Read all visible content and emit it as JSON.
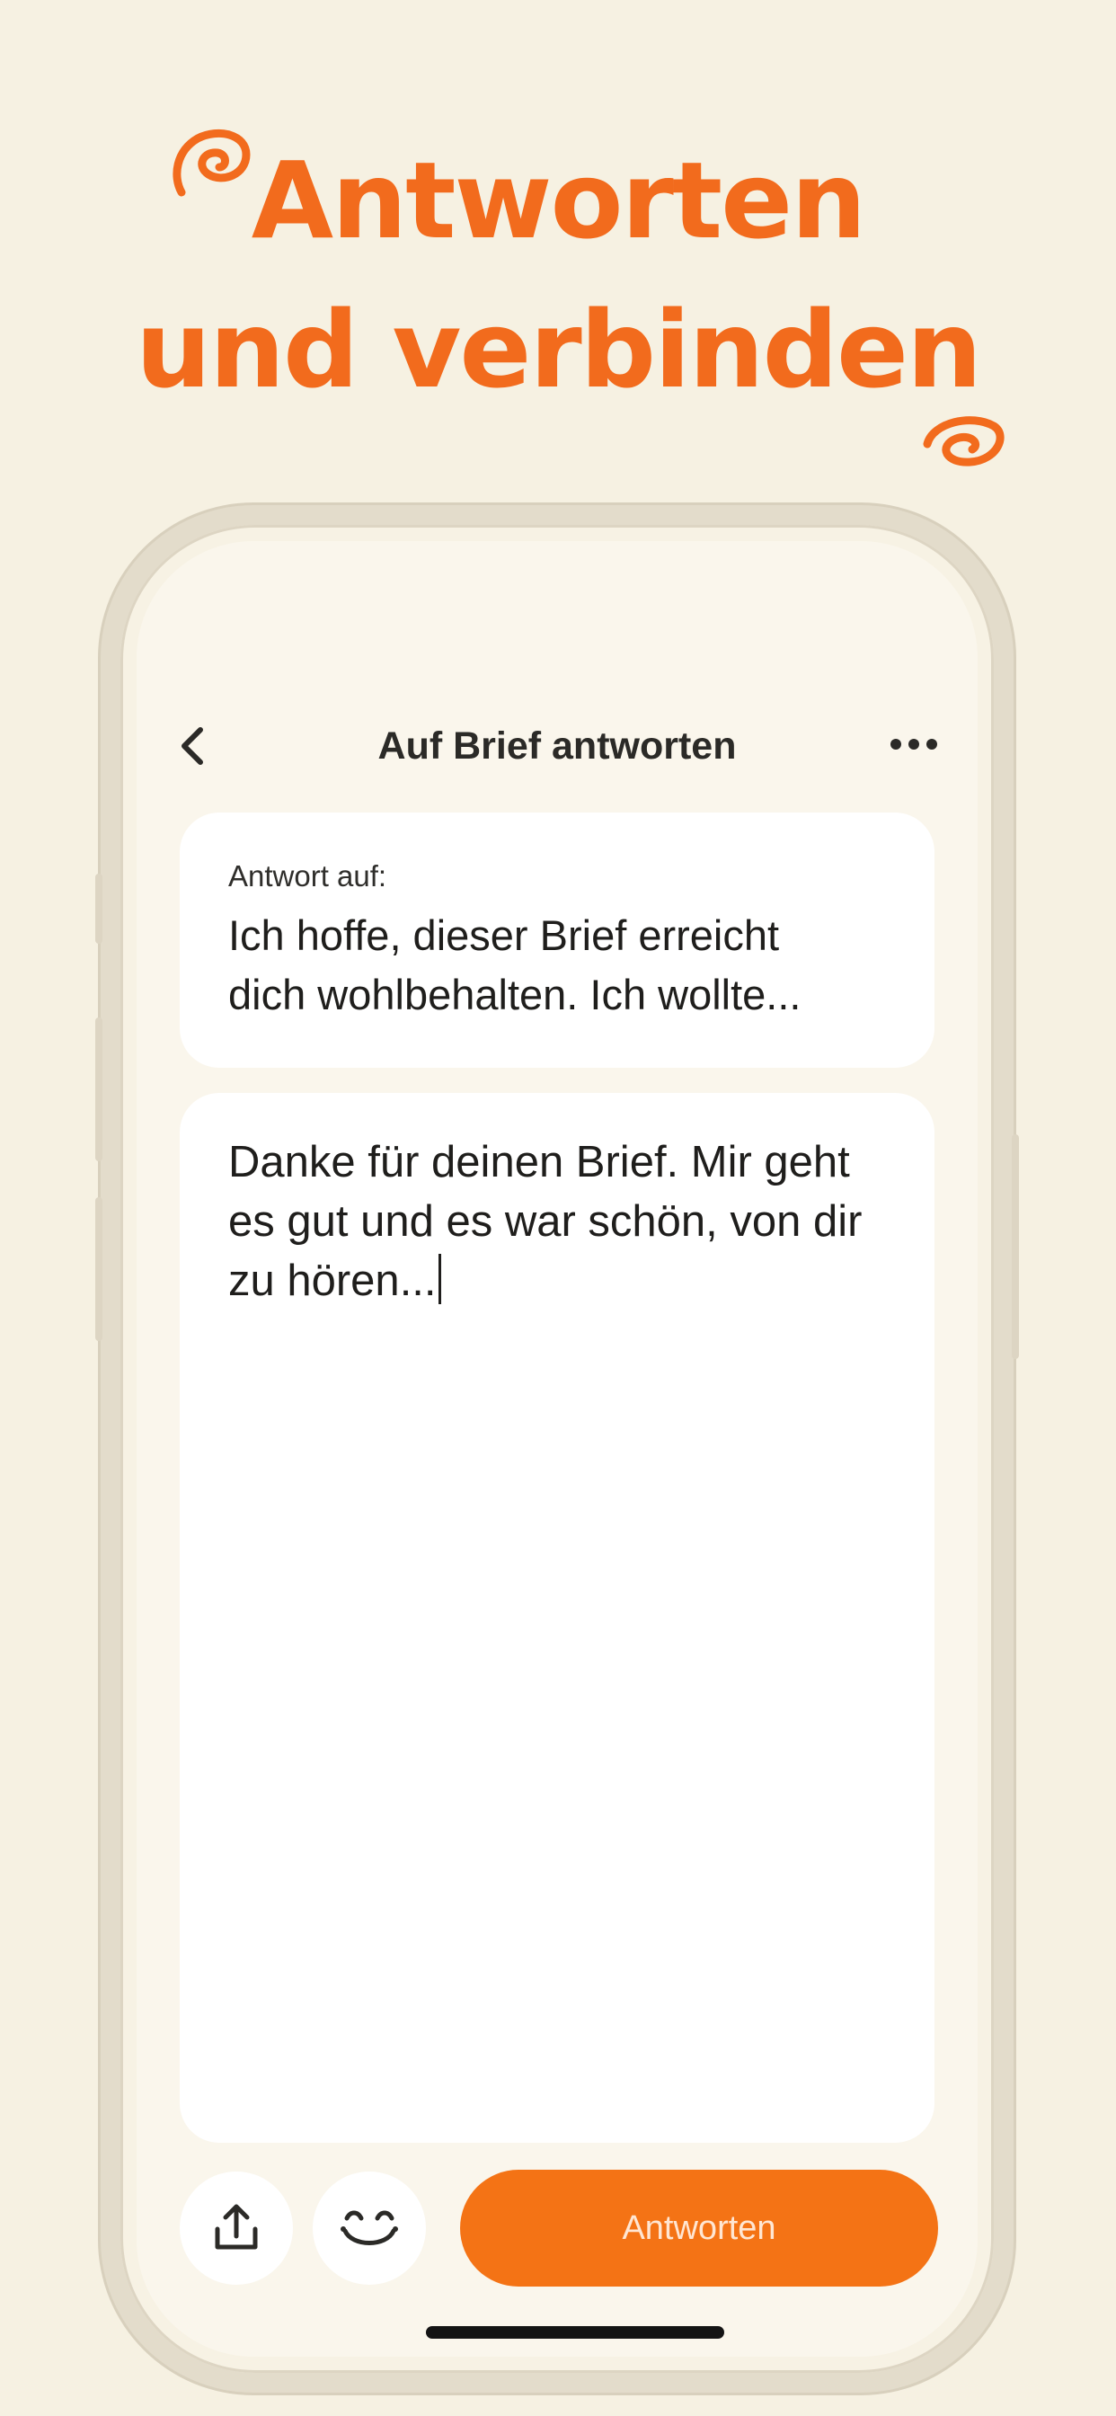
{
  "headline": {
    "line1": "Antworten",
    "line2": "und verbinden"
  },
  "nav": {
    "back_icon": "chevron-left-icon",
    "title": "Auf Brief antworten",
    "more_icon": "ellipsis-horizontal-icon"
  },
  "quote": {
    "label": "Antwort auf:",
    "line1": "Ich hoffe, dieser Brief erreicht",
    "line2": "dich wohlbehalten. Ich wollte..."
  },
  "reply": {
    "line1": "Danke für deinen Brief. Mir geht",
    "line2": "es gut und es war schön, von dir",
    "line3": "zu hören..."
  },
  "actions": {
    "share_icon": "share-upload-icon",
    "emoji_icon": "smiley-face-icon",
    "submit_label": "Antworten"
  },
  "colors": {
    "accent": "#f26b1d",
    "button": "#f47315",
    "background": "#f6f1e2"
  }
}
